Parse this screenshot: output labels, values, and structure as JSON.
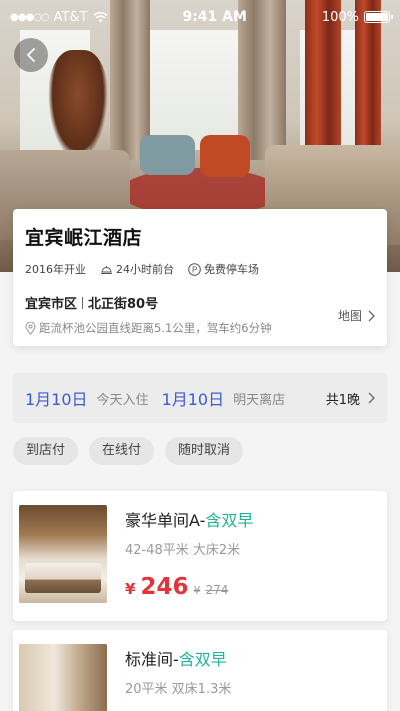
{
  "status_bar": {
    "carrier": "AT&T",
    "time": "9:41 AM",
    "battery": "100%"
  },
  "hotel": {
    "name": "宜宾岷江酒店",
    "meta": [
      {
        "icon": "none",
        "label": "2016年开业"
      },
      {
        "icon": "reception-bell-icon",
        "label": "24小时前台"
      },
      {
        "icon": "parking-icon",
        "label": "免费停车场"
      }
    ],
    "address": {
      "district": "宜宾市区",
      "street": "北正街80号",
      "distance": "距流杯池公园直线距离5.1公里，驾车约6分钟"
    },
    "map_label": "地图"
  },
  "booking": {
    "checkin_date": "1月10日",
    "checkin_label": "今天入住",
    "checkout_date": "1月10日",
    "checkout_label": "明天离店",
    "nights": "共1晚"
  },
  "tags": [
    "到店付",
    "在线付",
    "随时取消"
  ],
  "rooms": [
    {
      "name": "豪华单间A-",
      "breakfast": "含双早",
      "desc": "42-48平米 大床2米",
      "currency": "¥",
      "price": "246",
      "orig_currency": "¥",
      "orig_price": "274"
    },
    {
      "name": "标准间-",
      "breakfast": "含双早",
      "desc": "20平米 双床1.3米"
    }
  ],
  "colors": {
    "accent_blue": "#3d5bd6",
    "breakfast_green": "#21b39a",
    "price_red": "#e2343b"
  }
}
